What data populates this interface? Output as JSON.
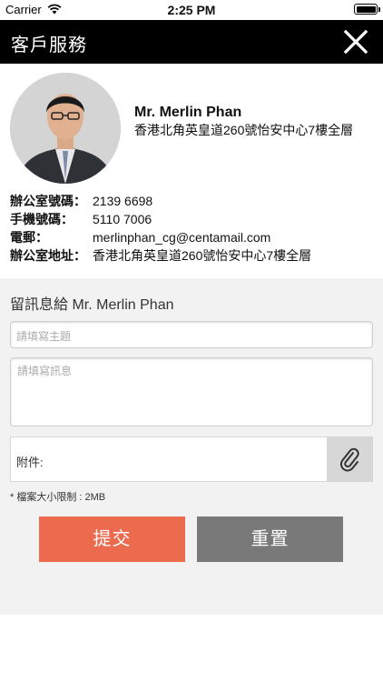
{
  "status_bar": {
    "carrier": "Carrier",
    "time": "2:25 PM"
  },
  "nav": {
    "title": "客戶服務"
  },
  "profile": {
    "name": "Mr. Merlin Phan",
    "address_header": "香港北角英皇道260號怡安中心7樓全層"
  },
  "info": [
    {
      "label": "辦公室號碼：",
      "value": "2139 6698"
    },
    {
      "label": "手機號碼：",
      "value": "5110 7006"
    },
    {
      "label": "電郵：",
      "value": "merlinphan_cg@centamail.com"
    },
    {
      "label": "辦公室地址：",
      "value": "香港北角英皇道260號怡安中心7樓全層"
    }
  ],
  "form": {
    "title": "留訊息給 Mr. Merlin Phan",
    "subject_placeholder": "請填寫主題",
    "message_placeholder": "請填寫訊息",
    "attachment_label": "附件:",
    "size_note": "* 檔案大小限制 : 2MB",
    "submit_label": "提交",
    "reset_label": "重置"
  },
  "colors": {
    "nav_bg": "#000000",
    "submit_bg": "#ec6a4d",
    "reset_bg": "#797979",
    "form_bg": "#f2f2f2"
  }
}
